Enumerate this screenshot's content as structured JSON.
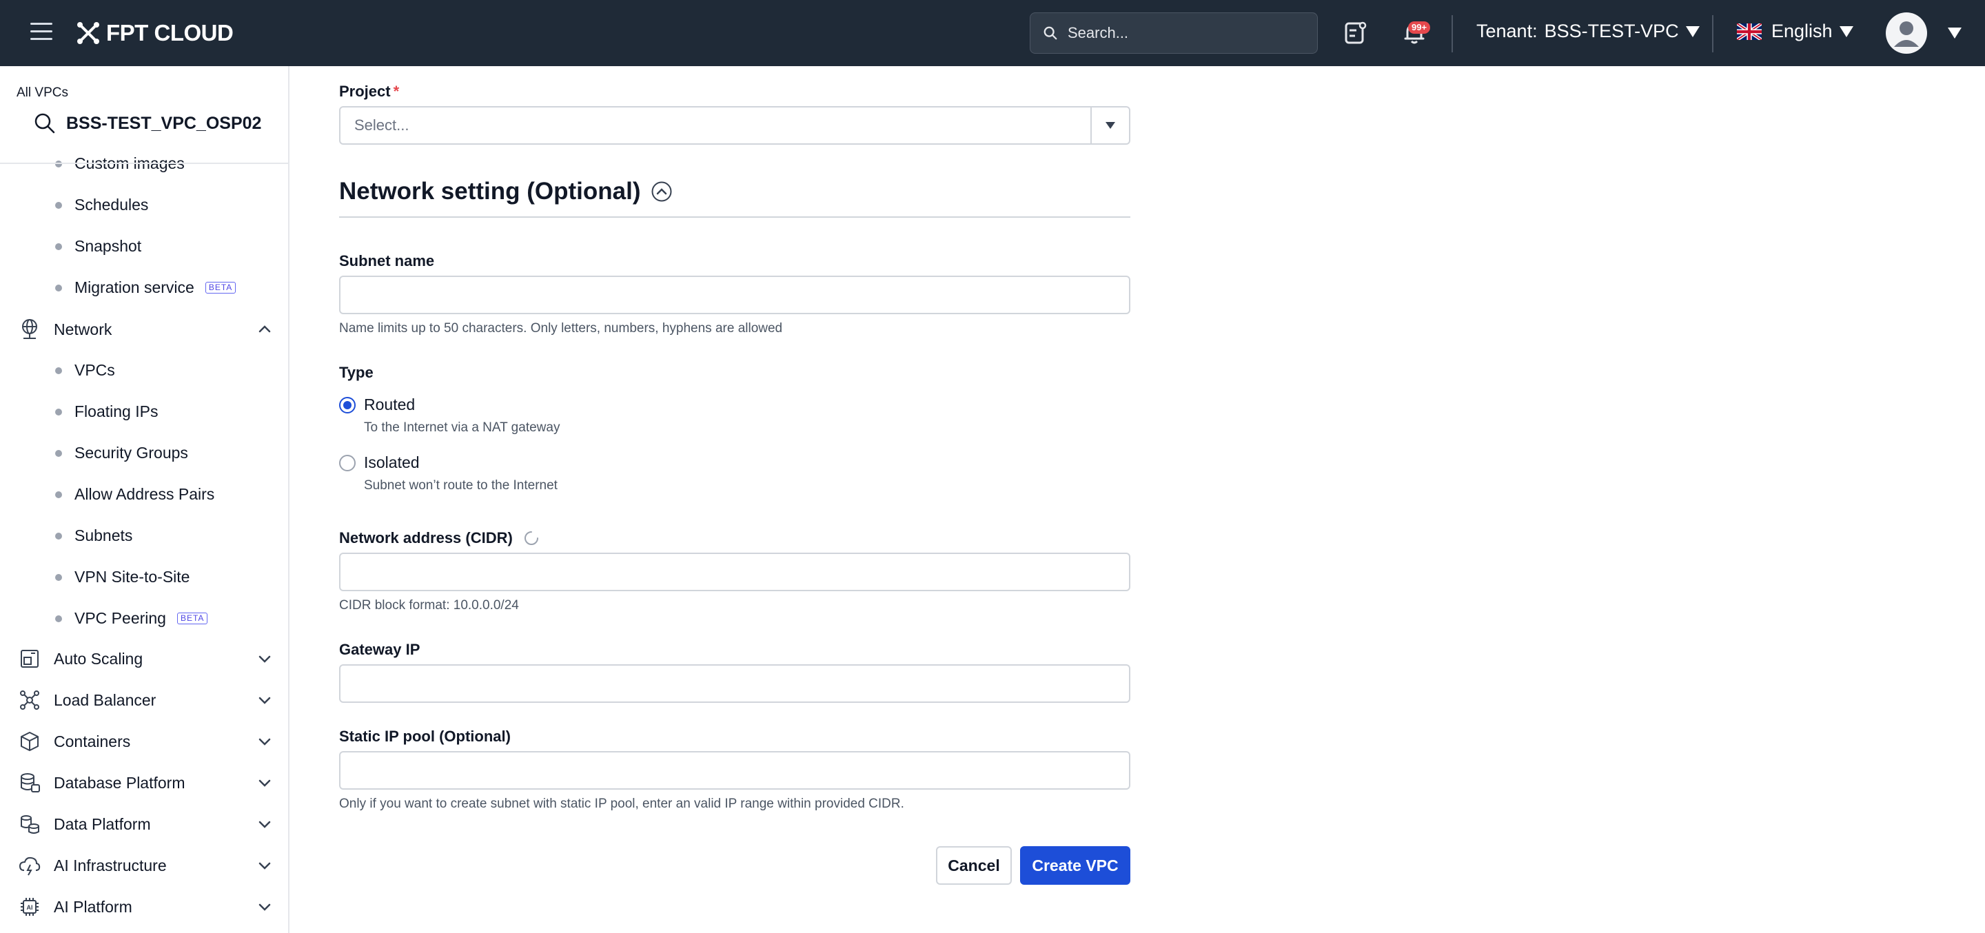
{
  "header": {
    "logo_text": "FPT CLOUD",
    "search_placeholder": "Search...",
    "notification_badge": "99+",
    "tenant_label": "Tenant:",
    "tenant_value": "BSS-TEST-VPC",
    "language": "English"
  },
  "sidebar": {
    "back_link": "All VPCs",
    "vpc_name": "BSS-TEST_VPC_OSP02",
    "compute_items": [
      {
        "label": "Custom images"
      },
      {
        "label": "Schedules"
      },
      {
        "label": "Snapshot"
      },
      {
        "label": "Migration service",
        "badge": "BETA"
      }
    ],
    "network": {
      "label": "Network",
      "items": [
        {
          "label": "VPCs"
        },
        {
          "label": "Floating IPs"
        },
        {
          "label": "Security Groups"
        },
        {
          "label": "Allow Address Pairs"
        },
        {
          "label": "Subnets"
        },
        {
          "label": "VPN Site-to-Site"
        },
        {
          "label": "VPC Peering",
          "badge": "BETA"
        }
      ]
    },
    "sections": [
      {
        "label": "Auto Scaling",
        "icon": "auto-scaling-icon"
      },
      {
        "label": "Load Balancer",
        "icon": "load-balancer-icon"
      },
      {
        "label": "Containers",
        "icon": "containers-icon"
      },
      {
        "label": "Database Platform",
        "icon": "database-icon"
      },
      {
        "label": "Data Platform",
        "icon": "data-platform-icon"
      },
      {
        "label": "AI Infrastructure",
        "icon": "ai-infrastructure-icon"
      },
      {
        "label": "AI Platform",
        "icon": "ai-platform-icon"
      }
    ]
  },
  "form": {
    "project_label": "Project",
    "required_mark": "*",
    "project_placeholder": "Select...",
    "network_section_title": "Network setting (Optional)",
    "subnet_name_label": "Subnet name",
    "subnet_name_value": "",
    "subnet_name_help": "Name limits up to 50 characters. Only letters, numbers, hyphens are allowed",
    "type_label": "Type",
    "type_options": [
      {
        "label": "Routed",
        "help": "To the Internet via a NAT gateway",
        "selected": true
      },
      {
        "label": "Isolated",
        "help": "Subnet won’t route to the Internet",
        "selected": false
      }
    ],
    "cidr_label": "Network address (CIDR)",
    "cidr_value": "",
    "cidr_help": "CIDR block format: 10.0.0.0/24",
    "gateway_label": "Gateway IP",
    "gateway_value": "",
    "static_pool_label": "Static IP pool (Optional)",
    "static_pool_value": "",
    "static_pool_help": "Only if you want to create subnet with static IP pool, enter an valid IP range within provided CIDR.",
    "cancel_label": "Cancel",
    "create_label": "Create VPC"
  },
  "colors": {
    "topbar": "#1f2a37",
    "primary": "#1d4ed8",
    "required": "#e5484d",
    "beta": "#4f46e5"
  }
}
